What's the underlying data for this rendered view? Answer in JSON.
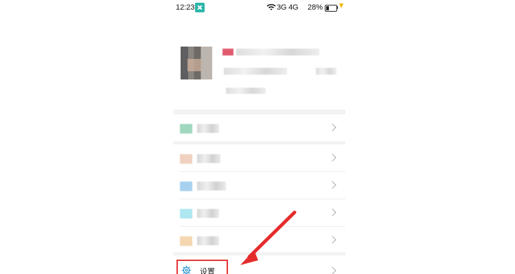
{
  "status_bar": {
    "time": "12:23",
    "network": "3G 4G",
    "battery_percent": "28%",
    "battery_fraction": 0.28
  },
  "menu": {
    "settings_label": "设置"
  },
  "icons": {
    "status_app": "scan-app-icon",
    "wifi": "wifi-icon",
    "battery": "battery-icon",
    "charging": "charging-bolt-icon",
    "menu_chevron": "chevron-right-icon",
    "settings": "gear-icon"
  },
  "colors": {
    "highlight": "#e33434",
    "status_app": "#2bb5a8",
    "settings_icon": "#1f8fd0",
    "chevron": "#a8a8a8"
  }
}
